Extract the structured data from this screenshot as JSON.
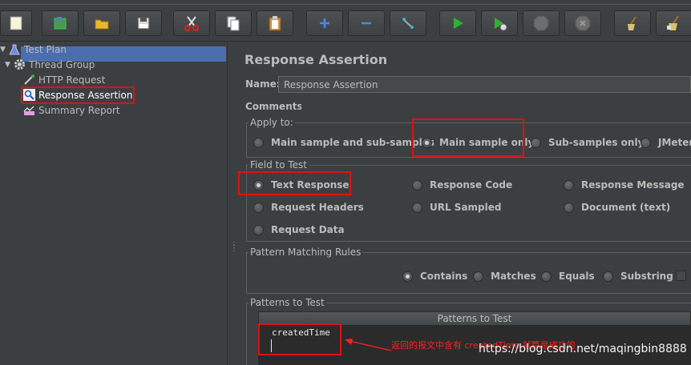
{
  "toolbar": {
    "buttons": [
      {
        "name": "new-button",
        "icon": "new-file-icon"
      },
      {
        "name": "templates-button",
        "icon": "templates-icon"
      },
      {
        "name": "open-button",
        "icon": "folder-open-icon"
      },
      {
        "name": "save-button",
        "icon": "save-disk-icon"
      },
      {
        "name": "cut-button",
        "icon": "scissors-icon"
      },
      {
        "name": "copy-button",
        "icon": "copy-icon"
      },
      {
        "name": "paste-button",
        "icon": "clipboard-icon"
      },
      {
        "name": "expand-all-button",
        "icon": "plus-icon"
      },
      {
        "name": "collapse-all-button",
        "icon": "minus-icon"
      },
      {
        "name": "toggle-button",
        "icon": "toggle-wand-icon"
      },
      {
        "name": "start-button",
        "icon": "play-icon"
      },
      {
        "name": "start-no-pauses-button",
        "icon": "play-no-timers-icon"
      },
      {
        "name": "stop-button",
        "icon": "stop-icon"
      },
      {
        "name": "shutdown-button",
        "icon": "shutdown-icon"
      },
      {
        "name": "clear-button",
        "icon": "broom-icon"
      },
      {
        "name": "clear-all-button",
        "icon": "broom-all-icon"
      }
    ]
  },
  "tree": {
    "items": [
      {
        "label": "Test Plan",
        "icon": "flask-icon"
      },
      {
        "label": "Thread Group",
        "icon": "gear-icon"
      },
      {
        "label": "HTTP Request",
        "icon": "pipette-icon"
      },
      {
        "label": "Response Assertion",
        "icon": "magnifier-icon",
        "selected": true
      },
      {
        "label": "Summary Report",
        "icon": "chart-icon"
      }
    ]
  },
  "panel": {
    "title": "Response Assertion",
    "name_label": "Name:",
    "name_value": "Response Assertion",
    "comments_label": "Comments:"
  },
  "apply_to": {
    "title": "Apply to:",
    "options": [
      {
        "label": "Main sample and sub-samples",
        "selected": false
      },
      {
        "label": "Main sample only",
        "selected": true
      },
      {
        "label": "Sub-samples only",
        "selected": false
      },
      {
        "label": "JMeter",
        "selected": false
      }
    ]
  },
  "field_to_test": {
    "title": "Field to Test",
    "options": [
      {
        "label": "Text Response",
        "selected": true
      },
      {
        "label": "Response Code",
        "selected": false
      },
      {
        "label": "Response Message",
        "selected": false
      },
      {
        "label": "Request Headers",
        "selected": false
      },
      {
        "label": "URL Sampled",
        "selected": false
      },
      {
        "label": "Document (text)",
        "selected": false
      },
      {
        "label": "Request Data",
        "selected": false
      }
    ]
  },
  "pattern_rules": {
    "title": "Pattern Matching Rules",
    "options": [
      {
        "label": "Contains",
        "selected": true
      },
      {
        "label": "Matches",
        "selected": false
      },
      {
        "label": "Equals",
        "selected": false
      },
      {
        "label": "Substring",
        "selected": false
      }
    ]
  },
  "patterns": {
    "title": "Patterns to Test",
    "column_header": "Patterns to Test",
    "rows": [
      "createdTime"
    ]
  },
  "annotation": {
    "text": "返回的报文中含有 createdTime 就算是成功的"
  },
  "watermark": "https://blog.csdn.net/maqingbin8888",
  "colors": {
    "background": "#3c3f41",
    "selection": "#4b6eaf",
    "highlight_box": "#e01010",
    "annotation_text": "#ff2020"
  }
}
